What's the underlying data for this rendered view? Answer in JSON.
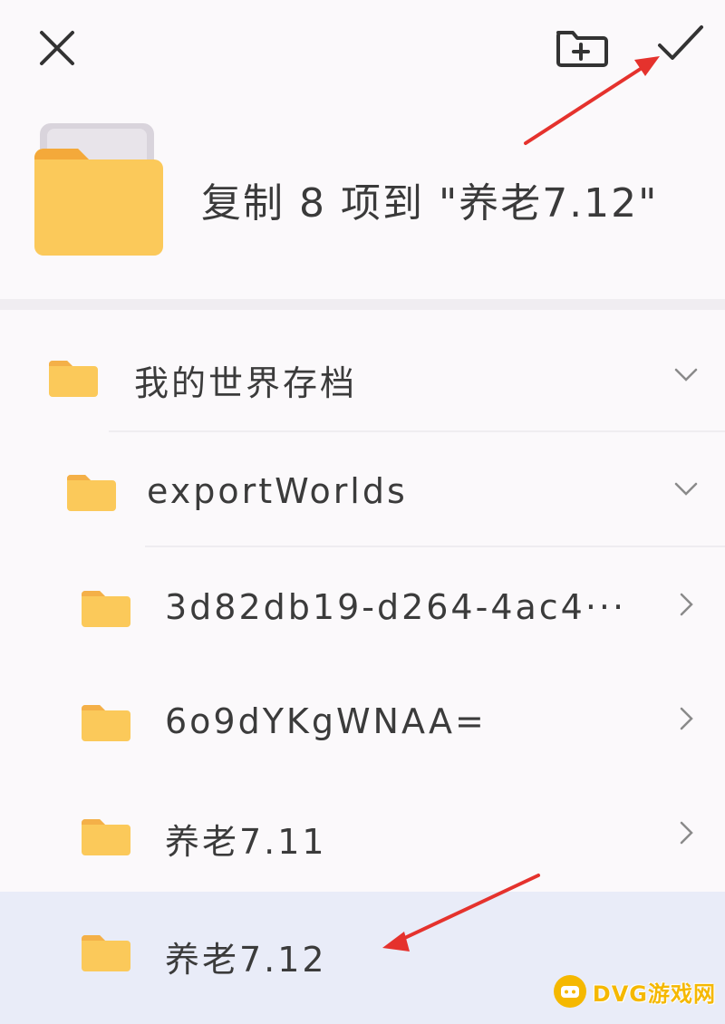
{
  "header": {
    "title": "复制 8 项到 \"养老7.12\""
  },
  "tree": [
    {
      "label": "我的世界存档",
      "chevron": "chevron-down-icon",
      "selected": false
    },
    {
      "label": "exportWorlds",
      "chevron": "chevron-down-icon",
      "selected": false
    },
    {
      "label": "3d82db19-d264-4ac4···",
      "chevron": "chevron-right-icon",
      "selected": false
    },
    {
      "label": "6o9dYKgWNAA=",
      "chevron": "chevron-right-icon",
      "selected": false
    },
    {
      "label": "养老7.11",
      "chevron": "chevron-right-icon",
      "selected": false
    },
    {
      "label": "养老7.12",
      "chevron": "",
      "selected": true
    }
  ],
  "watermark": {
    "text": "DVG游戏网"
  },
  "colors": {
    "folder": "#fbc95a",
    "folder_tab": "#f4a93a",
    "selected_row": "#e9ecf8",
    "annotation_arrow": "#e5322d"
  },
  "icons": [
    "close-icon",
    "new-folder-icon",
    "check-icon",
    "folder-icon",
    "chevron-down-icon",
    "chevron-right-icon"
  ]
}
